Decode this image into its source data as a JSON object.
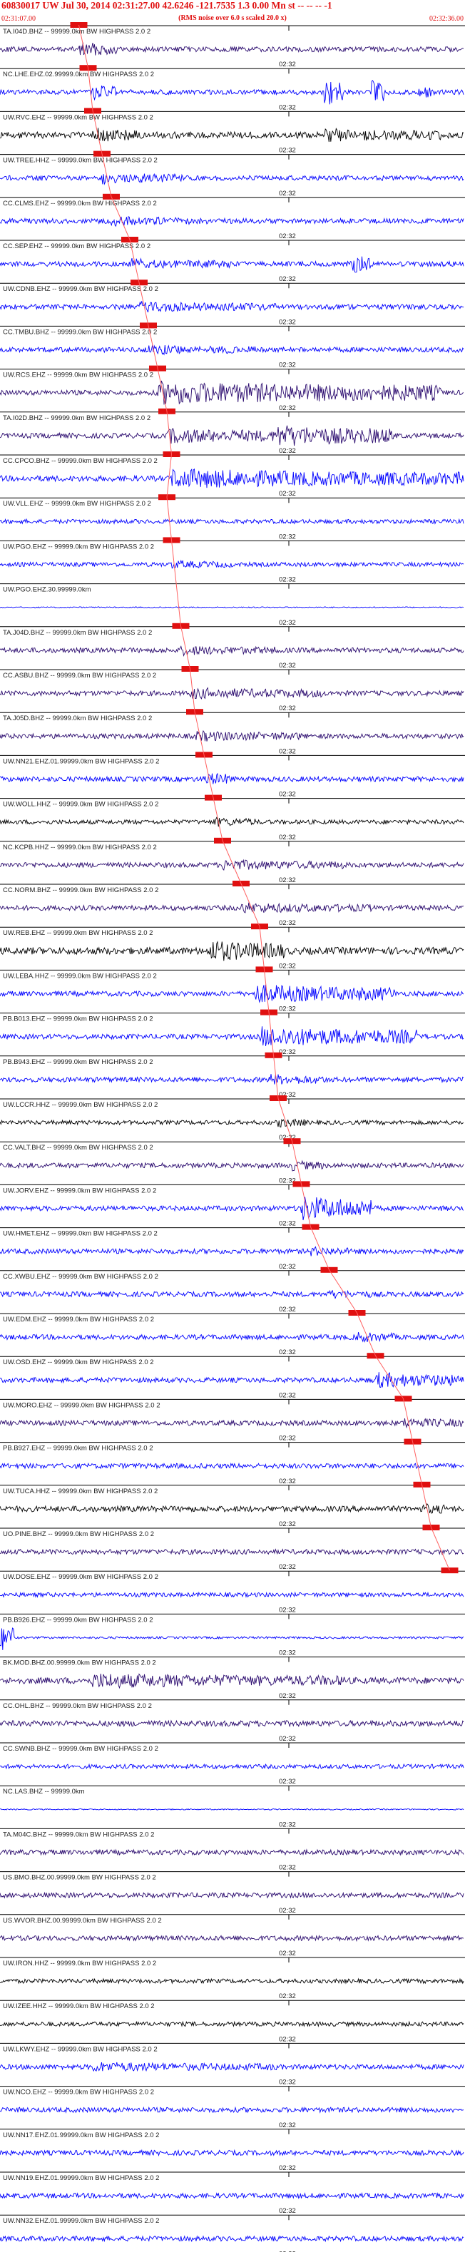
{
  "header": {
    "title": "60830017 UW Jul 30, 2014 02:31:27.00    42.6246 -121.7535  1.3 0.00 Mn st -- -- --  -1",
    "noise": "(RMS noise over 6.0 s scaled 20.0 x)",
    "start_time": "02:31:07.00",
    "end_time": "02:32:36.00"
  },
  "chart_data": {
    "type": "seismogram",
    "tick_label": "02:32",
    "colors": {
      "black": "#000000",
      "blue": "#0000ff",
      "purple": "#2a0a6e",
      "pick": "#e01010",
      "guide": "#ff6060",
      "grid": "#000000"
    },
    "traces": [
      {
        "label": "TA.I04D.BHZ -- 99999.0km BW  HIGHPASS  2.0  2",
        "color": "purple",
        "pick": 0.17,
        "amp": 0.35,
        "bursts": [
          [
            0.17,
            0.25,
            2.2
          ]
        ]
      },
      {
        "label": "NC.LHE.EHZ.02.99999.0km BW  HIGHPASS  2.0  2",
        "color": "blue",
        "pick": 0.19,
        "amp": 0.35,
        "bursts": [
          [
            0.19,
            0.25,
            2.5
          ],
          [
            0.7,
            0.74,
            4.0
          ],
          [
            0.8,
            0.83,
            3.5
          ],
          [
            0.9,
            0.93,
            2.0
          ]
        ]
      },
      {
        "label": "UW.RVC.EHZ -- 99999.0km BW  HIGHPASS  2.0  2",
        "color": "black",
        "pick": 0.2,
        "amp": 0.45,
        "bursts": [
          [
            0.2,
            0.3,
            1.8
          ],
          [
            0.7,
            0.95,
            1.6
          ]
        ]
      },
      {
        "label": "UW.TREE.HHZ -- 99999.0km BW  HIGHPASS  2.0  2",
        "color": "blue",
        "pick": 0.22,
        "amp": 0.35,
        "bursts": [
          [
            0.22,
            0.4,
            1.6
          ]
        ]
      },
      {
        "label": "CC.CLMS.EHZ -- 99999.0km BW  HIGHPASS  2.0  2",
        "color": "blue",
        "pick": 0.24,
        "amp": 0.35,
        "bursts": [
          [
            0.24,
            0.45,
            1.4
          ]
        ]
      },
      {
        "label": "CC.SEP.EHZ -- 99999.0km BW  HIGHPASS  2.0  2",
        "color": "blue",
        "pick": 0.28,
        "amp": 0.35,
        "bursts": [
          [
            0.28,
            0.5,
            1.5
          ],
          [
            0.76,
            0.8,
            3.0
          ]
        ]
      },
      {
        "label": "UW.CDNB.EHZ -- 99999.0km BW  HIGHPASS  2.0  2",
        "color": "blue",
        "pick": 0.3,
        "amp": 0.35,
        "bursts": [
          [
            0.3,
            0.6,
            1.5
          ]
        ]
      },
      {
        "label": "CC.TMBU.BHZ -- 99999.0km BW  HIGHPASS  2.0  2",
        "color": "blue",
        "pick": 0.32,
        "amp": 0.35,
        "bursts": [
          [
            0.32,
            0.55,
            1.4
          ]
        ]
      },
      {
        "label": "UW.RCS.EHZ -- 99999.0km BW  HIGHPASS  2.0  2",
        "color": "purple",
        "pick": 0.34,
        "amp": 0.35,
        "bursts": [
          [
            0.34,
            0.95,
            3.2
          ]
        ]
      },
      {
        "label": "TA.I02D.BHZ -- 99999.0km BW  HIGHPASS  2.0  2",
        "color": "purple",
        "pick": 0.36,
        "amp": 0.35,
        "bursts": [
          [
            0.36,
            0.6,
            2.2
          ],
          [
            0.6,
            0.85,
            3.0
          ]
        ]
      },
      {
        "label": "CC.CPCO.BHZ -- 99999.0km BW  HIGHPASS  2.0  2",
        "color": "blue",
        "pick": 0.37,
        "amp": 0.4,
        "bursts": [
          [
            0.37,
            1.0,
            2.5
          ]
        ]
      },
      {
        "label": "UW.VLL.EHZ -- 99999.0km BW  HIGHPASS  2.0  2",
        "color": "blue",
        "pick": 0.36,
        "amp": 0.3,
        "bursts": []
      },
      {
        "label": "UW.PGO.EHZ -- 99999.0km BW  HIGHPASS  2.0  2",
        "color": "blue",
        "pick": 0.37,
        "amp": 0.3,
        "bursts": [
          [
            0.37,
            0.5,
            1.3
          ]
        ]
      },
      {
        "label": "UW.PGO.EHZ.30.99999.0km",
        "color": "blue",
        "pick": null,
        "amp": 0.08,
        "bursts": []
      },
      {
        "label": "TA.J04D.BHZ -- 99999.0km BW  HIGHPASS  2.0  2",
        "color": "purple",
        "pick": 0.39,
        "amp": 0.35,
        "bursts": [
          [
            0.39,
            0.6,
            1.4
          ]
        ]
      },
      {
        "label": "CC.ASBU.BHZ -- 99999.0km BW  HIGHPASS  2.0  2",
        "color": "purple",
        "pick": 0.41,
        "amp": 0.35,
        "bursts": [
          [
            0.41,
            0.7,
            1.6
          ]
        ]
      },
      {
        "label": "TA.J05D.BHZ -- 99999.0km BW  HIGHPASS  2.0  2",
        "color": "purple",
        "pick": 0.42,
        "amp": 0.35,
        "bursts": [
          [
            0.42,
            0.65,
            1.5
          ]
        ]
      },
      {
        "label": "UW.NN21.EHZ.01.99999.0km BW  HIGHPASS  2.0  2",
        "color": "blue",
        "pick": 0.44,
        "amp": 0.35,
        "bursts": [
          [
            0.44,
            0.5,
            2.0
          ]
        ]
      },
      {
        "label": "UW.WOLL.HHZ -- 99999.0km BW  HIGHPASS  2.0  2",
        "color": "black",
        "pick": 0.46,
        "amp": 0.3,
        "bursts": [
          [
            0.46,
            0.55,
            1.5
          ]
        ]
      },
      {
        "label": "NC.KCPB.HHZ -- 99999.0km BW  HIGHPASS  2.0  2",
        "color": "purple",
        "pick": 0.48,
        "amp": 0.35,
        "bursts": [
          [
            0.48,
            0.75,
            1.5
          ]
        ]
      },
      {
        "label": "CC.NORM.BHZ -- 99999.0km BW  HIGHPASS  2.0  2",
        "color": "purple",
        "pick": 0.52,
        "amp": 0.35,
        "bursts": [
          [
            0.52,
            0.8,
            1.5
          ]
        ]
      },
      {
        "label": "UW.REB.EHZ -- 99999.0km BW  HIGHPASS  2.0  2",
        "color": "black",
        "pick": 0.56,
        "amp": 0.5,
        "bursts": [
          [
            0.45,
            0.62,
            2.5
          ]
        ]
      },
      {
        "label": "UW.LEBA.HHZ -- 99999.0km BW  HIGHPASS  2.0  2",
        "color": "blue",
        "pick": 0.57,
        "amp": 0.35,
        "bursts": [
          [
            0.55,
            0.85,
            2.6
          ]
        ]
      },
      {
        "label": "PB.B013.EHZ -- 99999.0km BW  HIGHPASS  2.0  2",
        "color": "blue",
        "pick": 0.58,
        "amp": 0.35,
        "bursts": [
          [
            0.56,
            0.9,
            2.8
          ]
        ]
      },
      {
        "label": "PB.B943.EHZ -- 99999.0km BW  HIGHPASS  2.0  2",
        "color": "blue",
        "pick": 0.59,
        "amp": 0.35,
        "bursts": [
          [
            0.58,
            0.7,
            1.6
          ]
        ]
      },
      {
        "label": "UW.LCCR.HHZ -- 99999.0km BW  HIGHPASS  2.0  2",
        "color": "black",
        "pick": 0.6,
        "amp": 0.3,
        "bursts": [
          [
            0.6,
            0.66,
            1.5
          ]
        ]
      },
      {
        "label": "CC.VALT.BHZ -- 99999.0km BW  HIGHPASS  2.0  2",
        "color": "purple",
        "pick": 0.63,
        "amp": 0.35,
        "bursts": [
          [
            0.63,
            0.7,
            1.5
          ]
        ]
      },
      {
        "label": "UW.JORV.EHZ -- 99999.0km BW  HIGHPASS  2.0  2",
        "color": "blue",
        "pick": 0.65,
        "amp": 0.35,
        "bursts": [
          [
            0.65,
            0.8,
            3.5
          ]
        ]
      },
      {
        "label": "UW.HMET.EHZ -- 99999.0km BW  HIGHPASS  2.0  2",
        "color": "blue",
        "pick": 0.67,
        "amp": 0.35,
        "bursts": [
          [
            0.67,
            0.75,
            1.4
          ]
        ]
      },
      {
        "label": "CC.XWBU.EHZ -- 99999.0km BW  HIGHPASS  2.0  2",
        "color": "blue",
        "pick": 0.71,
        "amp": 0.35,
        "bursts": [
          [
            0.71,
            0.8,
            1.3
          ]
        ]
      },
      {
        "label": "UW.EDM.EHZ -- 99999.0km BW  HIGHPASS  2.0  2",
        "color": "blue",
        "pick": 0.77,
        "amp": 0.35,
        "bursts": [
          [
            0.77,
            0.85,
            1.6
          ]
        ]
      },
      {
        "label": "UW.OSD.EHZ -- 99999.0km BW  HIGHPASS  2.0  2",
        "color": "blue",
        "pick": 0.81,
        "amp": 0.35,
        "bursts": [
          [
            0.81,
            1.0,
            2.2
          ]
        ]
      },
      {
        "label": "UW.MORO.EHZ -- 99999.0km BW  HIGHPASS  2.0  2",
        "color": "purple",
        "pick": 0.87,
        "amp": 0.35,
        "bursts": [
          [
            0.87,
            1.0,
            1.5
          ]
        ]
      },
      {
        "label": "PB.B927.EHZ -- 99999.0km BW  HIGHPASS  2.0  2",
        "color": "blue",
        "pick": 0.89,
        "amp": 0.35,
        "bursts": []
      },
      {
        "label": "UW.TUCA.HHZ -- 99999.0km BW  HIGHPASS  2.0  2",
        "color": "black",
        "pick": 0.91,
        "amp": 0.4,
        "bursts": [
          [
            0.91,
            0.96,
            1.6
          ]
        ]
      },
      {
        "label": "UO.PINE.BHZ -- 99999.0km BW  HIGHPASS  2.0  2",
        "color": "purple",
        "pick": 0.93,
        "amp": 0.35,
        "bursts": []
      },
      {
        "label": "UW.DOSE.EHZ -- 99999.0km BW  HIGHPASS  2.0  2",
        "color": "blue",
        "pick": 0.97,
        "amp": 0.3,
        "bursts": []
      },
      {
        "label": "PB.B926.EHZ -- 99999.0km BW  HIGHPASS  2.0  2",
        "color": "blue",
        "pick": null,
        "amp": 0.15,
        "bursts": [
          [
            0.0,
            0.03,
            6.0
          ]
        ]
      },
      {
        "label": "BK.MOD.BHZ.00.99999.0km BW  HIGHPASS  2.0  2",
        "color": "purple",
        "pick": null,
        "amp": 0.45,
        "bursts": [
          [
            0.2,
            0.75,
            1.8
          ]
        ]
      },
      {
        "label": "CC.OHL.BHZ -- 99999.0km BW  HIGHPASS  2.0  2",
        "color": "purple",
        "pick": null,
        "amp": 0.4,
        "bursts": []
      },
      {
        "label": "CC.SWNB.BHZ -- 99999.0km BW  HIGHPASS  2.0  2",
        "color": "blue",
        "pick": null,
        "amp": 0.3,
        "bursts": []
      },
      {
        "label": "NC.LAS.BHZ -- 99999.0km",
        "color": "blue",
        "pick": null,
        "amp": 0.08,
        "bursts": []
      },
      {
        "label": "TA.M04C.BHZ -- 99999.0km BW  HIGHPASS  2.0  2",
        "color": "purple",
        "pick": null,
        "amp": 0.35,
        "bursts": []
      },
      {
        "label": "US.BMO.BHZ.00.99999.0km BW  HIGHPASS  2.0  2",
        "color": "purple",
        "pick": null,
        "amp": 0.35,
        "bursts": []
      },
      {
        "label": "US.WVOR.BHZ.00.99999.0km BW  HIGHPASS  2.0  2",
        "color": "purple",
        "pick": null,
        "amp": 0.35,
        "bursts": []
      },
      {
        "label": "UW.IRON.HHZ -- 99999.0km BW  HIGHPASS  2.0  2",
        "color": "black",
        "pick": null,
        "amp": 0.3,
        "bursts": []
      },
      {
        "label": "UW.IZEE.HHZ -- 99999.0km BW  HIGHPASS  2.0  2",
        "color": "black",
        "pick": null,
        "amp": 0.3,
        "bursts": []
      },
      {
        "label": "UW.LKWY.EHZ -- 99999.0km BW  HIGHPASS  2.0  2",
        "color": "blue",
        "pick": null,
        "amp": 0.35,
        "bursts": [
          [
            0.2,
            0.6,
            1.4
          ]
        ]
      },
      {
        "label": "UW.NCO.EHZ -- 99999.0km BW  HIGHPASS  2.0  2",
        "color": "blue",
        "pick": null,
        "amp": 0.35,
        "bursts": []
      },
      {
        "label": "UW.NN17.EHZ.01.99999.0km BW  HIGHPASS  2.0  2",
        "color": "blue",
        "pick": null,
        "amp": 0.35,
        "bursts": []
      },
      {
        "label": "UW.NN19.EHZ.01.99999.0km BW  HIGHPASS  2.0  2",
        "color": "blue",
        "pick": null,
        "amp": 0.35,
        "bursts": []
      },
      {
        "label": "UW.NN32.EHZ.01.99999.0km BW  HIGHPASS  2.0  2",
        "color": "blue",
        "pick": null,
        "amp": 0.35,
        "bursts": []
      }
    ]
  }
}
